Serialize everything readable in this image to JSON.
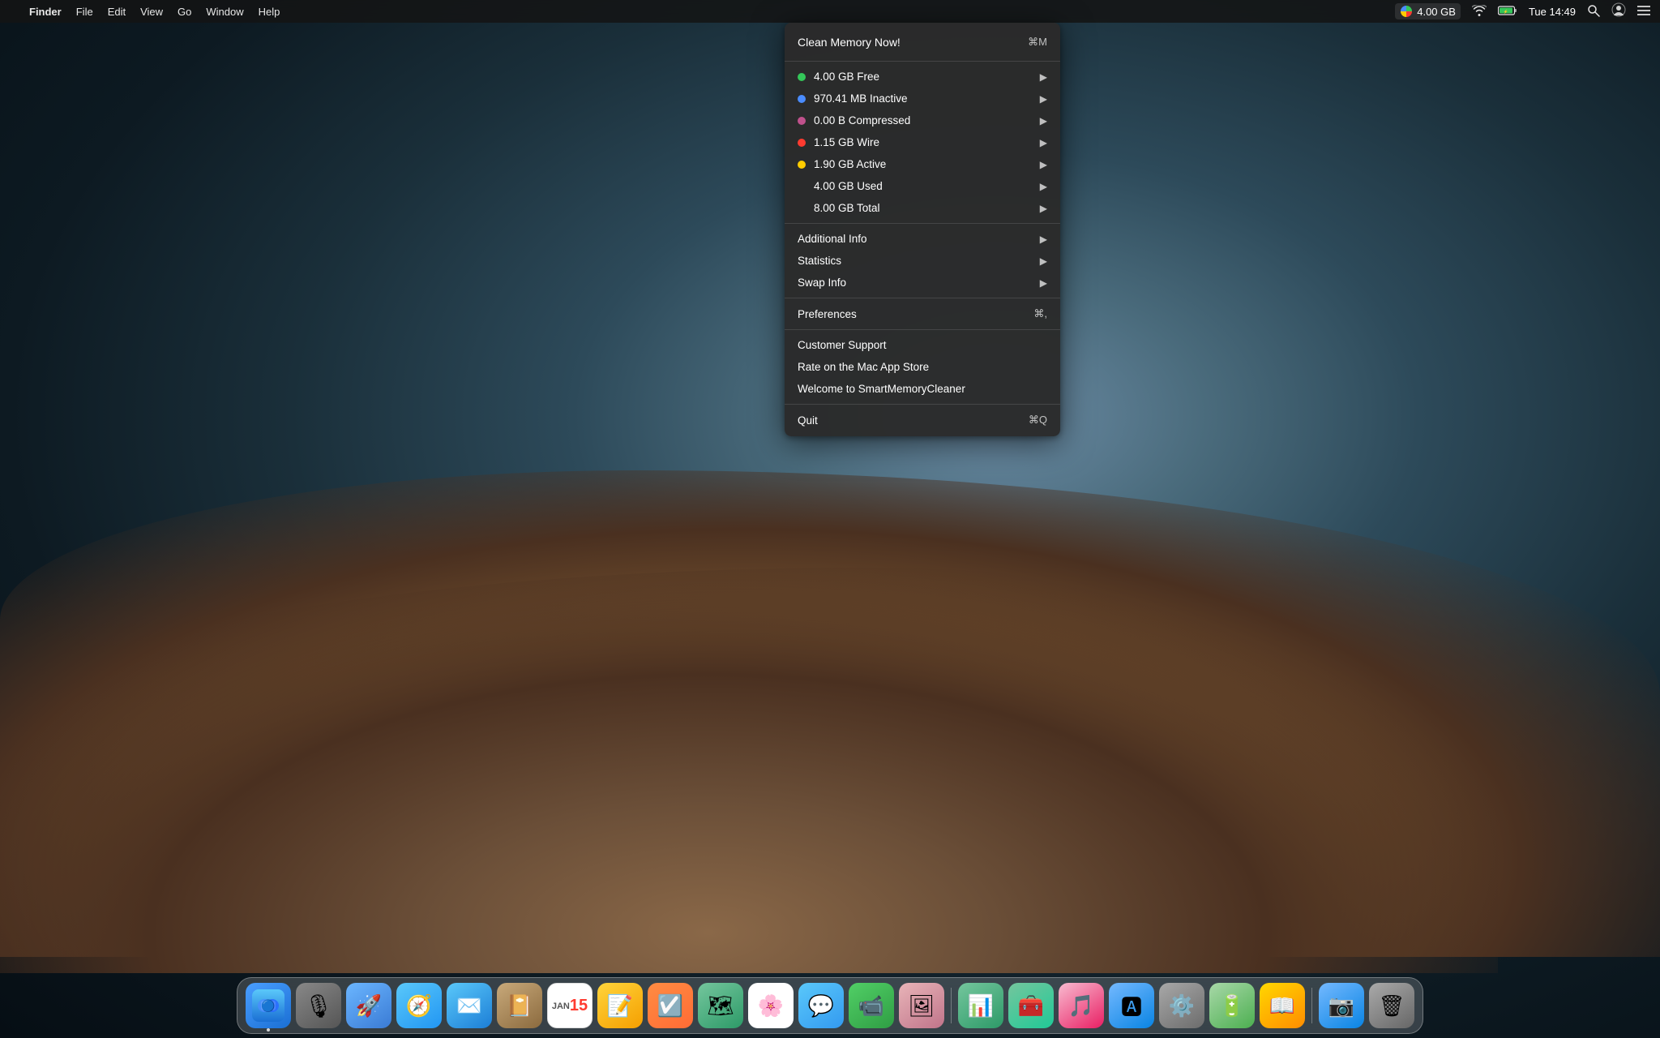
{
  "menubar": {
    "apple": "",
    "items": [
      "Finder",
      "File",
      "Edit",
      "View",
      "Go",
      "Window",
      "Help"
    ],
    "right": {
      "memory_amount": "4.00 GB",
      "wifi_icon": "wifi",
      "battery_icon": "battery",
      "time": "Tue 14:49",
      "search_icon": "search",
      "portrait_icon": "portrait",
      "list_icon": "list"
    }
  },
  "dropdown": {
    "clean_memory": {
      "label": "Clean Memory Now!",
      "shortcut": "⌘M"
    },
    "memory_items": [
      {
        "label": "4.00 GB Free",
        "dot_color": "green",
        "has_arrow": true
      },
      {
        "label": "970.41 MB Inactive",
        "dot_color": "blue",
        "has_arrow": true
      },
      {
        "label": "0.00 B Compressed",
        "dot_color": "pink",
        "has_arrow": true
      },
      {
        "label": "1.15 GB Wire",
        "dot_color": "red",
        "has_arrow": true
      },
      {
        "label": "1.90 GB Active",
        "dot_color": "yellow",
        "has_arrow": true
      },
      {
        "label": "4.00 GB Used",
        "dot_color": "none",
        "has_arrow": true
      },
      {
        "label": "8.00 GB Total",
        "dot_color": "none",
        "has_arrow": true
      }
    ],
    "submenu_items": [
      {
        "label": "Additional Info",
        "has_arrow": true
      },
      {
        "label": "Statistics",
        "has_arrow": true
      },
      {
        "label": "Swap Info",
        "has_arrow": true
      }
    ],
    "preferences": {
      "label": "Preferences",
      "shortcut": "⌘,"
    },
    "support_items": [
      {
        "label": "Customer Support"
      },
      {
        "label": "Rate on the Mac App Store"
      },
      {
        "label": "Welcome to SmartMemoryCleaner"
      }
    ],
    "quit": {
      "label": "Quit",
      "shortcut": "⌘Q"
    }
  },
  "dock": {
    "apps": [
      {
        "name": "Finder",
        "class": "dock-finder",
        "icon": "🔵",
        "has_dot": true
      },
      {
        "name": "Siri",
        "class": "dock-siri",
        "icon": "🎙",
        "has_dot": false
      },
      {
        "name": "Launchpad",
        "class": "dock-launchpad",
        "icon": "🚀",
        "has_dot": false
      },
      {
        "name": "Safari",
        "class": "dock-safari",
        "icon": "🧭",
        "has_dot": false
      },
      {
        "name": "Mail",
        "class": "dock-mail",
        "icon": "✉️",
        "has_dot": false
      },
      {
        "name": "Notefile",
        "class": "dock-notefile",
        "icon": "📔",
        "has_dot": false
      },
      {
        "name": "Calendar",
        "class": "dock-calendar",
        "icon": "📅",
        "has_dot": false
      },
      {
        "name": "Notes",
        "class": "dock-notes",
        "icon": "📝",
        "has_dot": false
      },
      {
        "name": "Reminders",
        "class": "dock-reminders",
        "icon": "☑️",
        "has_dot": false
      },
      {
        "name": "Maps",
        "class": "dock-maps",
        "icon": "🗺",
        "has_dot": false
      },
      {
        "name": "Photos",
        "class": "dock-photos",
        "icon": "🌸",
        "has_dot": false
      },
      {
        "name": "Messages",
        "class": "dock-messages",
        "icon": "💬",
        "has_dot": false
      },
      {
        "name": "Facetime",
        "class": "dock-facetime",
        "icon": "📹",
        "has_dot": false
      },
      {
        "name": "Photos2",
        "class": "dock-photos2",
        "icon": "🖼",
        "has_dot": false
      },
      {
        "name": "Numbers",
        "class": "dock-numbers",
        "icon": "📊",
        "has_dot": false
      },
      {
        "name": "Toolbox",
        "class": "dock-toolbox",
        "icon": "🧰",
        "has_dot": false
      },
      {
        "name": "Music",
        "class": "dock-music",
        "icon": "🎵",
        "has_dot": false
      },
      {
        "name": "AppStore",
        "class": "dock-appstore",
        "icon": "🅰",
        "has_dot": false
      },
      {
        "name": "Preferences",
        "class": "dock-prefs",
        "icon": "⚙️",
        "has_dot": false
      },
      {
        "name": "Battery",
        "class": "dock-battery",
        "icon": "🔋",
        "has_dot": false
      },
      {
        "name": "Lexi",
        "class": "dock-lexi",
        "icon": "📖",
        "has_dot": false
      },
      {
        "name": "Screenshot",
        "class": "dock-screenshot",
        "icon": "📷",
        "has_dot": false
      },
      {
        "name": "Trash",
        "class": "dock-trash",
        "icon": "🗑",
        "has_dot": false
      }
    ]
  }
}
